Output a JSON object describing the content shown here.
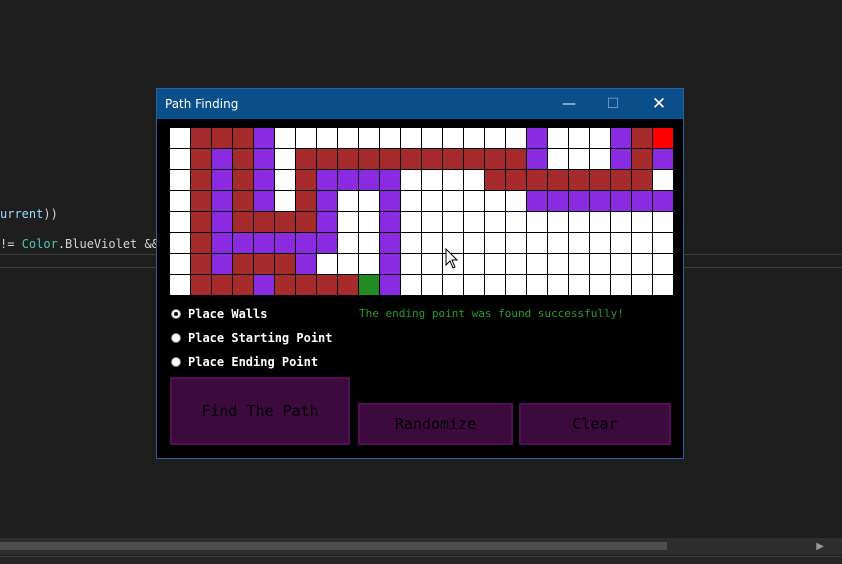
{
  "editor": {
    "code_line_1_part1": "urrent",
    "code_line_1_part2": "))",
    "code_line_2_part1": "!= ",
    "code_line_2_part2": "Color",
    "code_line_2_part3": ".BlueViolet &&"
  },
  "window": {
    "title": "Path Finding",
    "minimize_glyph": "—",
    "maximize_glyph": "☐",
    "close_glyph": "✕"
  },
  "grid": {
    "rows": 8,
    "cols": 24,
    "legend": {
      "W": "white",
      "B": "wall",
      "V": "visited",
      "R": "end",
      "G": "start"
    },
    "colors": {
      "W": "#ffffff",
      "B": "#a72a2d",
      "V": "#8a2be2",
      "R": "#ff0000",
      "G": "#228b22"
    },
    "cells": [
      "WBBBVWWWWWWWWWWWWVWWWVBR",
      "WBVBVWBBBBBBBBBBBVWWWVBV",
      "WBVBVWBVVVVWWWWBBBBBBBBW",
      "WBVBVWBVWWVWWWWWWVVVVVVV",
      "WBVBBBBVWWVWWWWWWWWWWWWW",
      "WBVVVVVVWWVWWWWWWWWWWWWW",
      "WBVBBBVWWWVWWWWWWWWWWWWW",
      "WBBBVBBBBGVWWWWWWWWWWWWW"
    ]
  },
  "options": [
    {
      "label": "Place Walls",
      "checked": true
    },
    {
      "label": "Place Starting Point",
      "checked": false
    },
    {
      "label": "Place Ending Point",
      "checked": false
    }
  ],
  "status_text": "The ending point was found successfully!",
  "buttons": {
    "find": "Find The Path",
    "randomize": "Randomize",
    "clear": "Clear"
  },
  "colors": {
    "button_bg": "#3d0a3d",
    "status": "#2e9b2e",
    "titlebar": "#0a4e8a"
  }
}
